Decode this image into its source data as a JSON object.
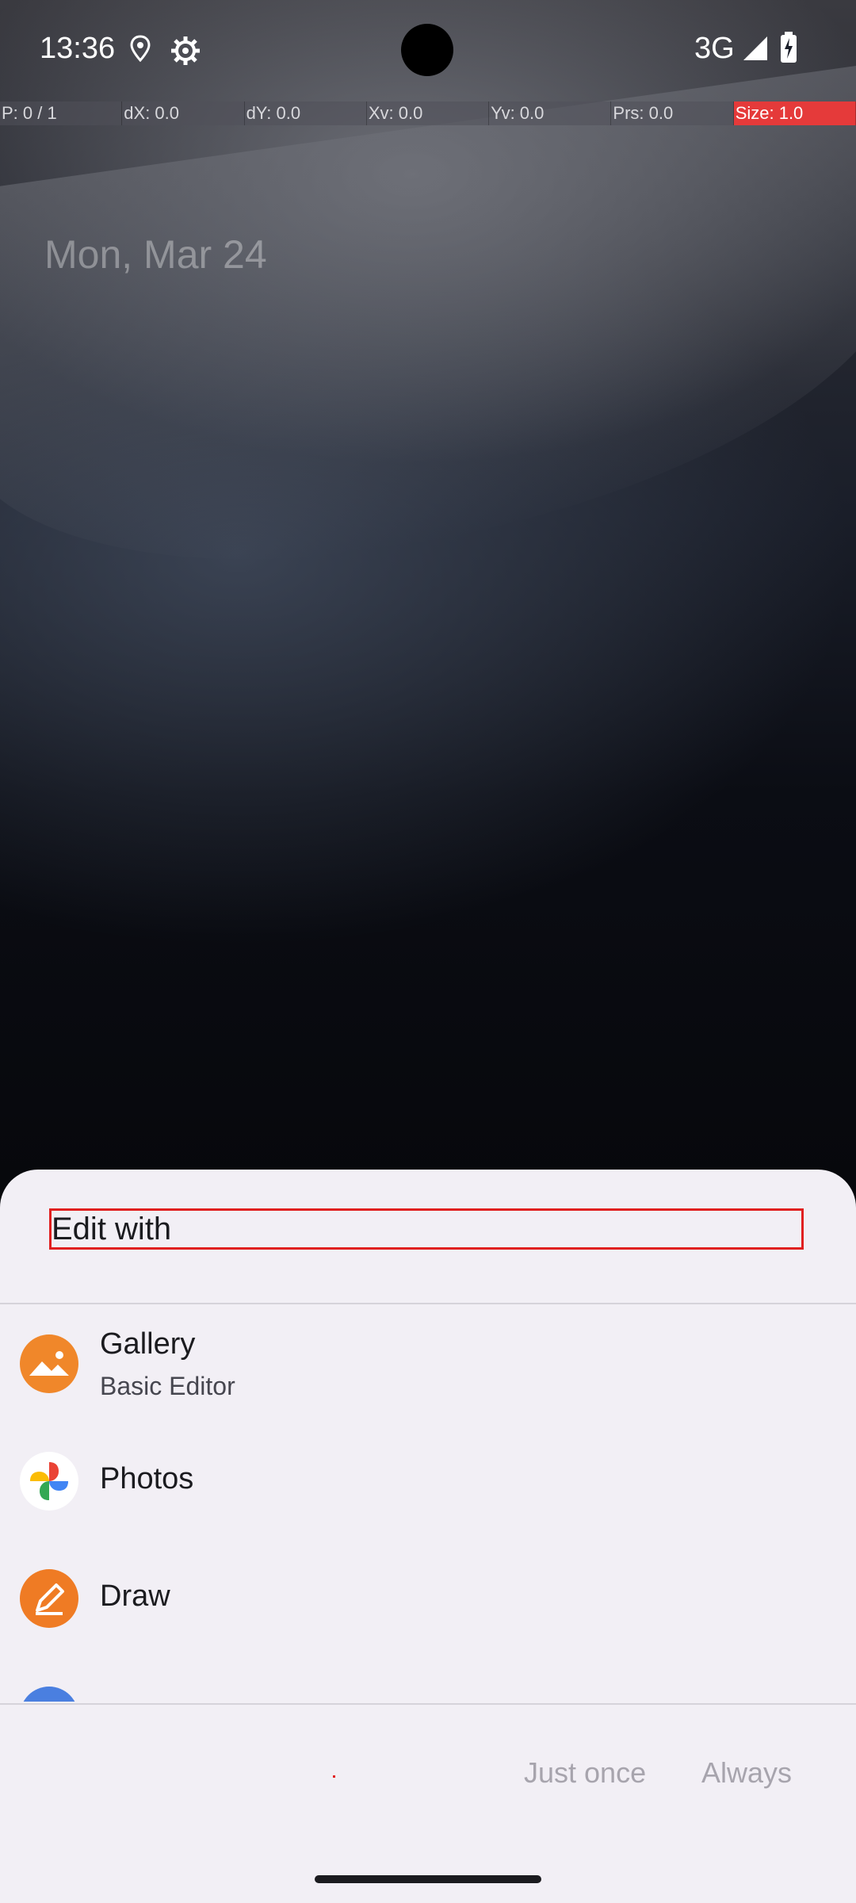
{
  "status_bar": {
    "time": "13:36",
    "network": "3G",
    "icons": [
      "location-icon",
      "settings-gear-icon",
      "signal-icon",
      "battery-charging-icon"
    ]
  },
  "pointer_overlay": {
    "cells": [
      "P: 0 / 1",
      "dX: 0.0",
      "dY: 0.0",
      "Xv: 0.0",
      "Yv: 0.0",
      "Prs: 0.0",
      "Size: 1.0"
    ]
  },
  "lockscreen": {
    "date": "Mon, Mar 24"
  },
  "sheet": {
    "title": "Edit with",
    "apps": [
      {
        "name": "Gallery",
        "subtitle": "Basic Editor",
        "icon": "gallery-icon"
      },
      {
        "name": "Photos",
        "subtitle": "",
        "icon": "photos-icon"
      },
      {
        "name": "Draw",
        "subtitle": "",
        "icon": "draw-icon"
      },
      {
        "name": "",
        "subtitle": "",
        "icon": "markup-icon"
      }
    ],
    "buttons": {
      "just_once": "Just once",
      "always": "Always"
    }
  },
  "colors": {
    "sheet_background": "#f2eff5",
    "highlight_border": "#e02020",
    "gallery_orange": "#f0872a",
    "draw_orange": "#ef7b24",
    "markup_blue": "#4a7fe0"
  }
}
